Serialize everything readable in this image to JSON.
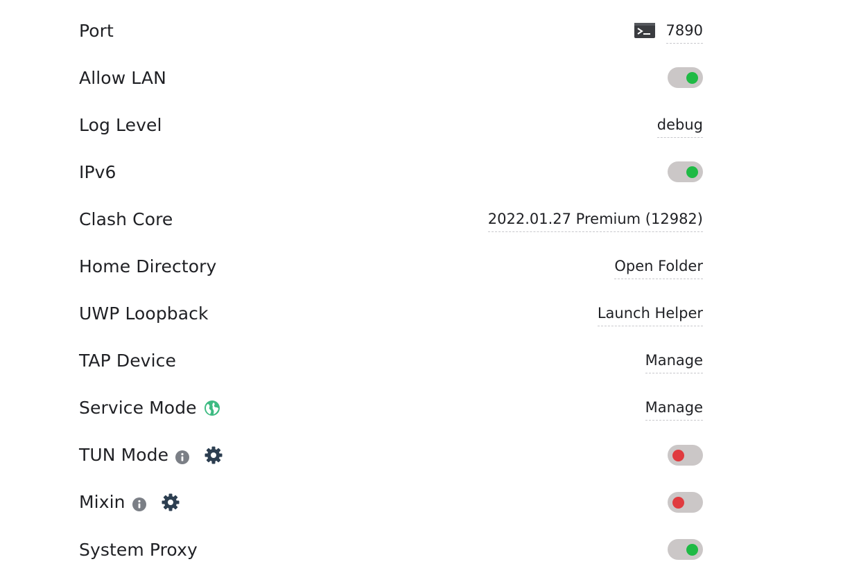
{
  "settings": {
    "port": {
      "label": "Port",
      "value": "7890",
      "icon": "terminal-icon"
    },
    "allow_lan": {
      "label": "Allow LAN",
      "state": "on"
    },
    "log_level": {
      "label": "Log Level",
      "value": "debug"
    },
    "ipv6": {
      "label": "IPv6",
      "state": "on"
    },
    "clash_core": {
      "label": "Clash Core",
      "value": "2022.01.27 Premium (12982)"
    },
    "home_directory": {
      "label": "Home Directory",
      "value": "Open Folder"
    },
    "uwp_loopback": {
      "label": "UWP Loopback",
      "value": "Launch Helper"
    },
    "tap_device": {
      "label": "TAP Device",
      "value": "Manage"
    },
    "service_mode": {
      "label": "Service Mode",
      "value": "Manage",
      "icon": "globe-icon"
    },
    "tun_mode": {
      "label": "TUN Mode",
      "state": "off",
      "icons": [
        "info-icon",
        "gear-icon"
      ]
    },
    "mixin": {
      "label": "Mixin",
      "state": "off",
      "icons": [
        "info-icon",
        "gear-icon"
      ]
    },
    "system_proxy": {
      "label": "System Proxy",
      "state": "on"
    }
  },
  "colors": {
    "toggle_track": "#cbc7c7",
    "toggle_on": "#1fba45",
    "toggle_off": "#e03b3f",
    "globe": "#3dbb82",
    "icon_dark": "#2c3e50",
    "info": "#7b7f86"
  }
}
